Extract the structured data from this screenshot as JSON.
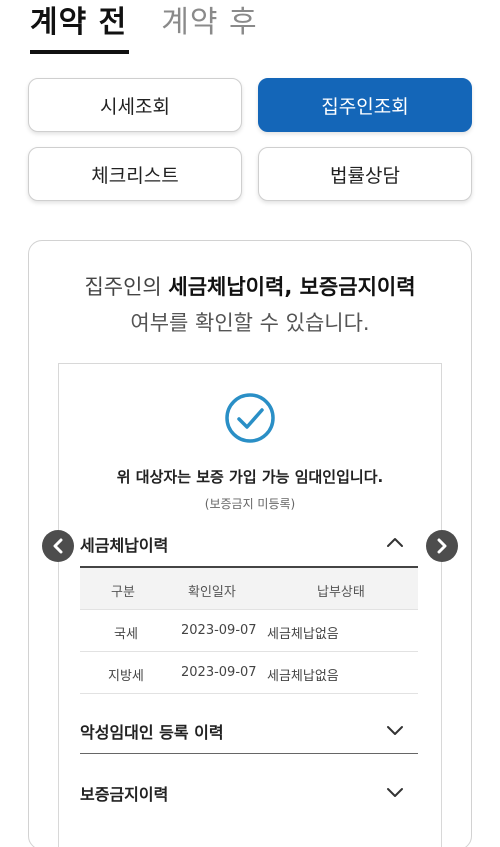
{
  "tabs": [
    {
      "label": "계약 전",
      "active": true
    },
    {
      "label": "계약 후",
      "active": false
    }
  ],
  "buttons": {
    "price_lookup": "시세조회",
    "landlord_lookup": "집주인조회",
    "checklist": "체크리스트",
    "legal_consult": "법률상담"
  },
  "headline": {
    "prefix": "집주인의 ",
    "bold": "세금체납이력, 보증금지이력",
    "line2": "여부를 확인할 수 있습니다."
  },
  "result": {
    "status": "위 대상자는 보증 가입 가능 임대인입니다.",
    "note": "(보증금지 미등록)"
  },
  "tax_section": {
    "title": "세금체납이력",
    "columns": [
      "구분",
      "확인일자",
      "납부상태"
    ],
    "rows": [
      {
        "type": "국세",
        "date": "2023-09-07",
        "state": "세금체납없음"
      },
      {
        "type": "지방세",
        "date": "2023-09-07",
        "state": "세금체납없음"
      }
    ]
  },
  "malicious_section": {
    "title": "악성임대인 등록 이력"
  },
  "ban_section": {
    "title": "보증금지이력"
  },
  "colors": {
    "primary": "#1466b8",
    "check": "#2a8fc6"
  }
}
